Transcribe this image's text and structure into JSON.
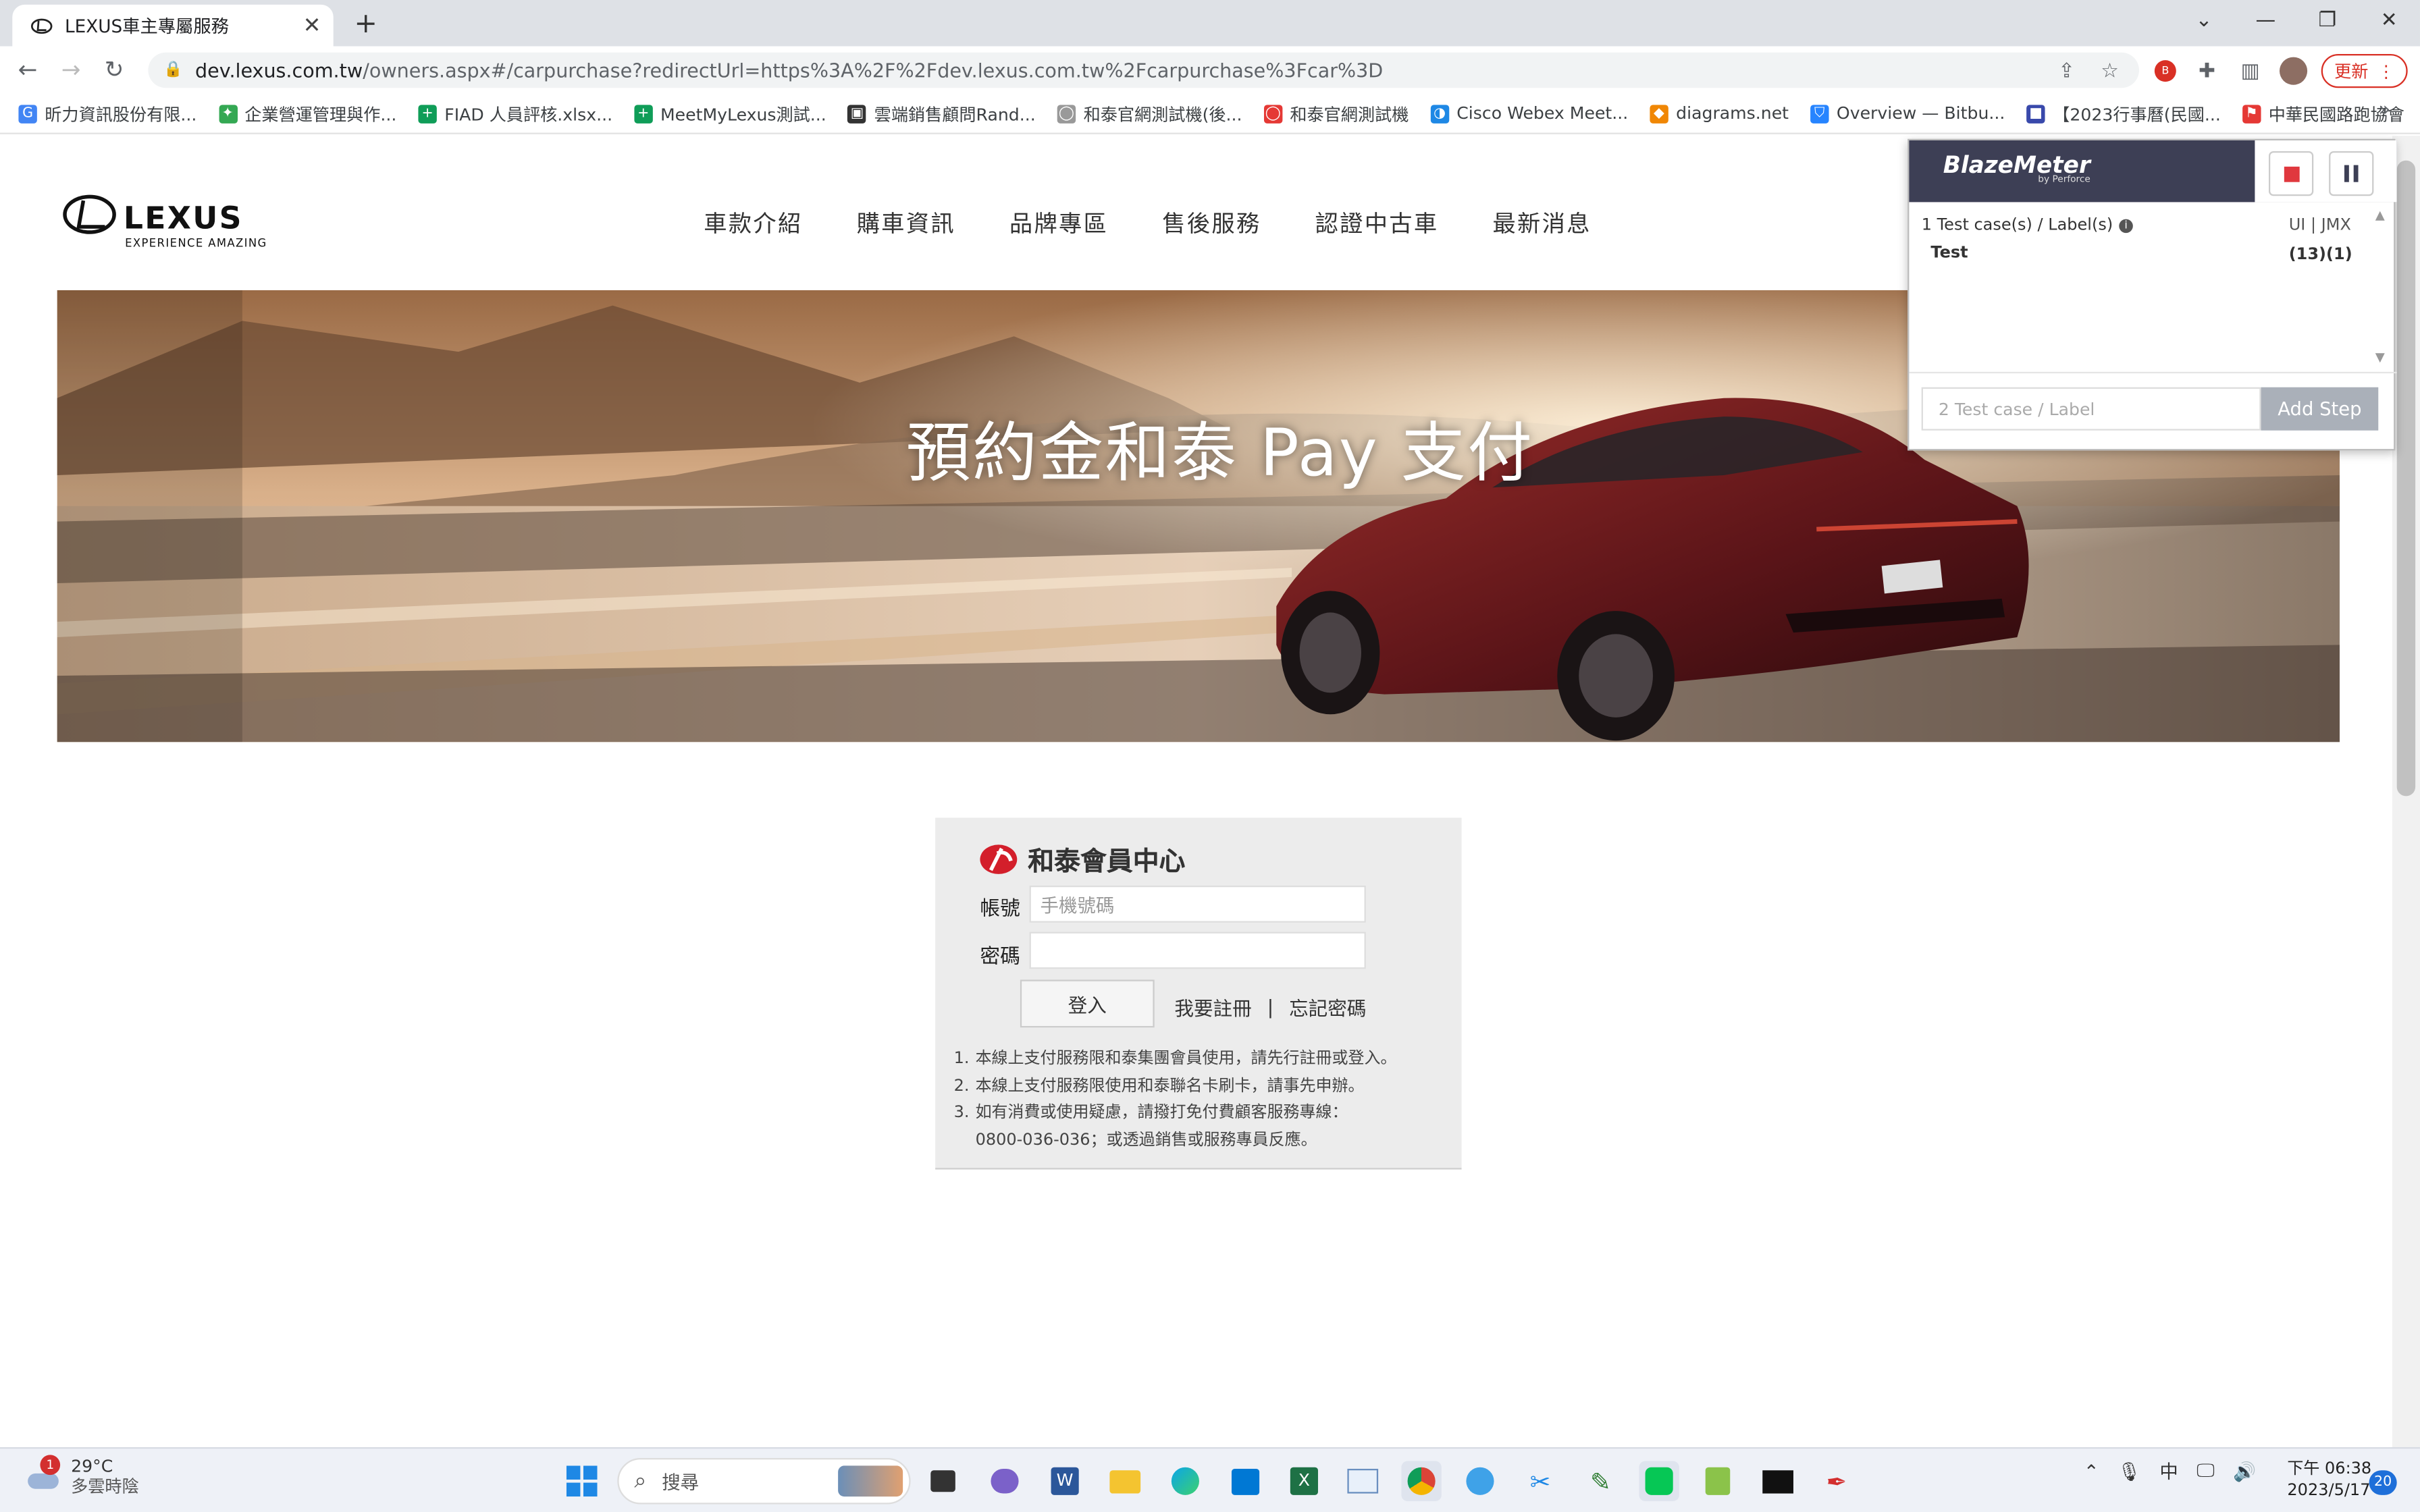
{
  "browser": {
    "tab_title": "LEXUS車主專屬服務",
    "tab_close": "✕",
    "new_tab": "+",
    "url_host": "dev.lexus.com.tw",
    "url_path": "/owners.aspx#/carpurchase?redirectUrl=https%3A%2F%2Fdev.lexus.com.tw%2Fcarpurchase%3Fcar%3D",
    "update_label": "更新"
  },
  "bookmarks": [
    {
      "label": "昕力資訊股份有限...",
      "color": "#4285f4",
      "icon": "G"
    },
    {
      "label": "企業營運管理與作...",
      "color": "#34a853",
      "icon": "✦"
    },
    {
      "label": "FIAD 人員評核.xlsx...",
      "color": "#0f9d58",
      "icon": "+"
    },
    {
      "label": "MeetMyLexus測試...",
      "color": "#0f9d58",
      "icon": "+"
    },
    {
      "label": "雲端銷售顧問Rand...",
      "color": "#333333",
      "icon": "▣"
    },
    {
      "label": "和泰官網測試機(後...",
      "color": "#999999",
      "icon": "◯"
    },
    {
      "label": "和泰官網測試機",
      "color": "#e53935",
      "icon": "◯"
    },
    {
      "label": "Cisco Webex Meet...",
      "color": "#1e88e5",
      "icon": "◑"
    },
    {
      "label": "diagrams.net",
      "color": "#f08705",
      "icon": "◆"
    },
    {
      "label": "Overview — Bitbu...",
      "color": "#2684ff",
      "icon": "⛉"
    },
    {
      "label": "【2023行事曆(民國...",
      "color": "#3949ab",
      "icon": "■"
    },
    {
      "label": "中華民國路跑協會",
      "color": "#e53935",
      "icon": "⚑"
    }
  ],
  "bookmarks_overflow": "»",
  "site": {
    "logo_text": "LEXUS",
    "logo_tagline": "EXPERIENCE AMAZING",
    "menu": [
      "車款介紹",
      "購車資訊",
      "品牌專區",
      "售後服務",
      "認證中古車",
      "最新消息"
    ],
    "hero_title": "預約金和泰 Pay 支付"
  },
  "login": {
    "title": "和泰會員中心",
    "account_label": "帳號",
    "account_placeholder": "手機號碼",
    "password_label": "密碼",
    "login_button": "登入",
    "register_link": "我要註冊",
    "separator": "|",
    "forgot_link": "忘記密碼",
    "notes": [
      {
        "n": "1.",
        "text": "本線上支付服務限和泰集團會員使用，請先行註冊或登入。"
      },
      {
        "n": "2.",
        "text": "本線上支付服務限使用和泰聯名卡刷卡，請事先申辦。"
      },
      {
        "n": "3.",
        "text": "如有消費或使用疑慮，請撥打免付費顧客服務專線："
      },
      {
        "n": "",
        "text": "0800-036-036；或透過銷售或服務專員反應。"
      }
    ]
  },
  "blazemeter": {
    "brand": "BlazeMeter",
    "brand_sub": "by Perforce",
    "summary": "1 Test case(s) / Label(s)",
    "views": "UI | JMX",
    "case_name": "Test",
    "case_counts": "(13)(1)",
    "input_placeholder": "2 Test case / Label",
    "add_step": "Add Step"
  },
  "taskbar": {
    "weather_badge": "1",
    "temperature": "29°C",
    "weather_text": "多雲時陰",
    "search_label": "搜尋",
    "ime": "中",
    "time": "下午 06:38",
    "date": "2023/5/17",
    "notif_count": "20"
  }
}
